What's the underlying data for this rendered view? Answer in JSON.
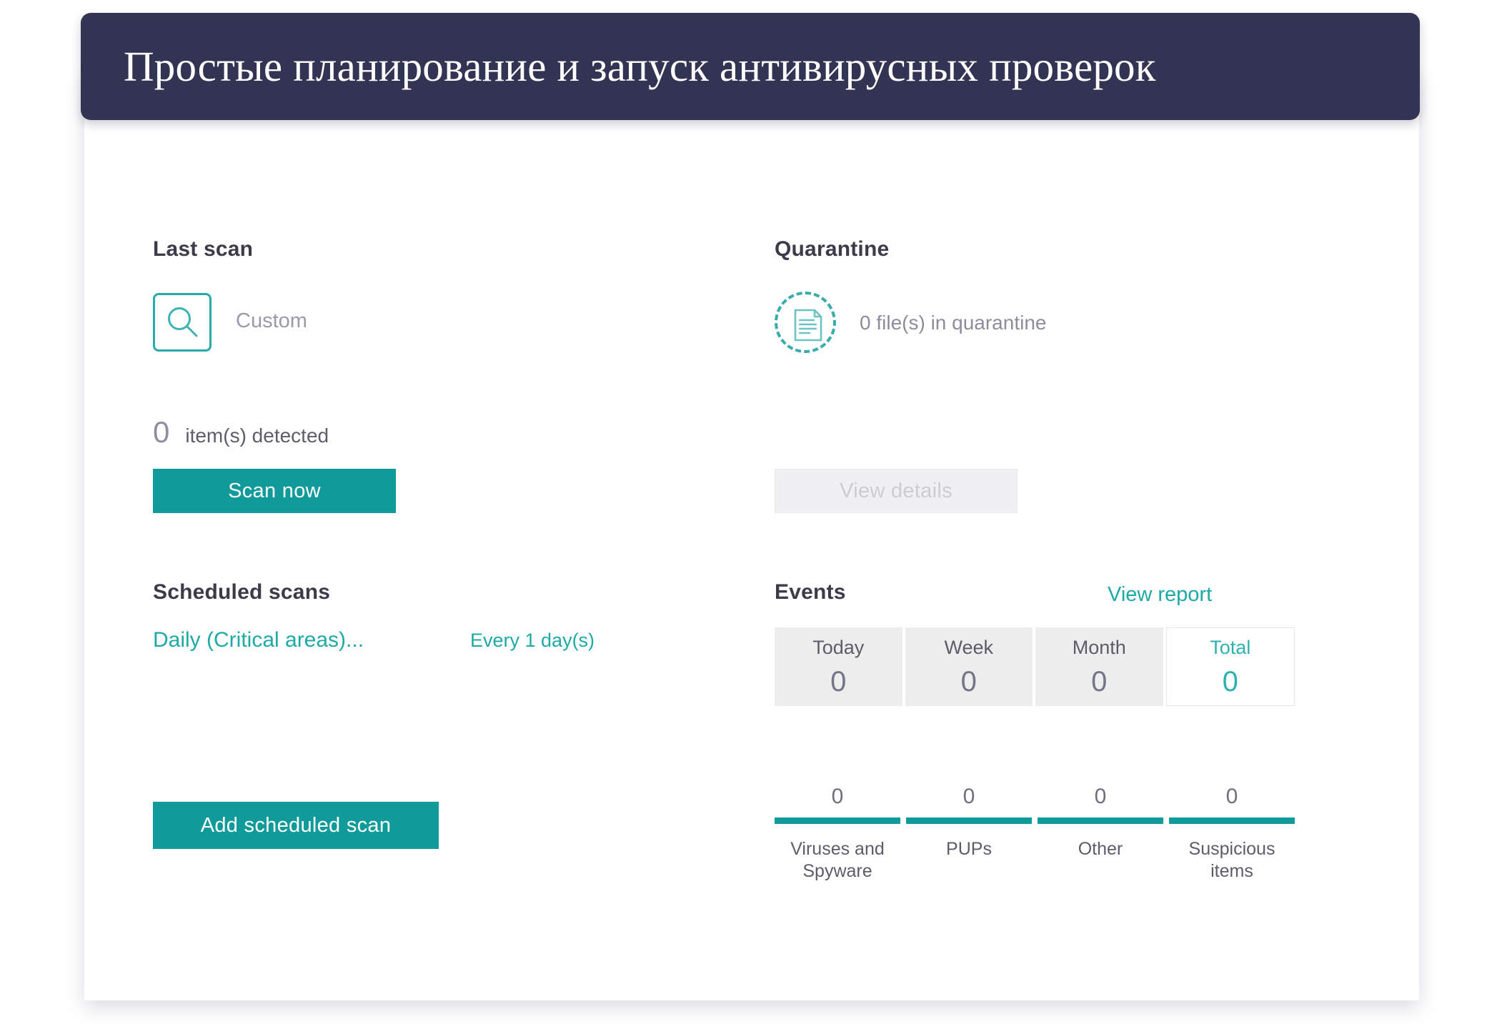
{
  "header": {
    "title": "Простые планирование и запуск антивирусных проверок"
  },
  "colors": {
    "header_bg": "#333353",
    "accent_teal": "#119a9a",
    "link_teal": "#1fa9a4",
    "tab_bg": "#ededed",
    "disabled_bg": "#f0f0f2",
    "disabled_text": "#ccccd4"
  },
  "last_scan": {
    "heading": "Last scan",
    "scan_type": "Custom",
    "detected_count": "0",
    "detected_label": "item(s) detected",
    "scan_button": "Scan now",
    "icon": "magnifier-icon"
  },
  "quarantine": {
    "heading": "Quarantine",
    "status": "0 file(s) in quarantine",
    "view_details_button": "View details",
    "icon": "quarantine-document-icon"
  },
  "scheduled_scans": {
    "heading": "Scheduled scans",
    "items": [
      {
        "name": "Daily (Critical areas)...",
        "frequency": "Every 1 day(s)"
      }
    ],
    "add_button": "Add scheduled scan"
  },
  "events": {
    "heading": "Events",
    "view_report_link": "View report",
    "tabs": [
      {
        "label": "Today",
        "value": "0",
        "active": false
      },
      {
        "label": "Week",
        "value": "0",
        "active": false
      },
      {
        "label": "Month",
        "value": "0",
        "active": false
      },
      {
        "label": "Total",
        "value": "0",
        "active": true
      }
    ],
    "threat_stats": [
      {
        "label": "Viruses and Spyware",
        "value": "0"
      },
      {
        "label": "PUPs",
        "value": "0"
      },
      {
        "label": "Other",
        "value": "0"
      },
      {
        "label": "Suspicious items",
        "value": "0"
      }
    ]
  }
}
